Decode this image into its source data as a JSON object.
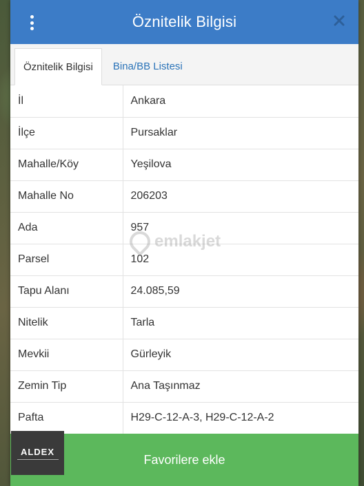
{
  "header": {
    "title": "Öznitelik Bilgisi",
    "colors": {
      "header_bg": "#3c7cc7",
      "button_bg": "#5cb85c",
      "tab_link": "#2a73b8"
    }
  },
  "tabs": [
    {
      "label": "Öznitelik Bilgisi",
      "active": true
    },
    {
      "label": "Bina/BB Listesi",
      "active": false
    }
  ],
  "attributes": [
    {
      "key": "İl",
      "value": "Ankara"
    },
    {
      "key": "İlçe",
      "value": "Pursaklar"
    },
    {
      "key": "Mahalle/Köy",
      "value": "Yeşilova"
    },
    {
      "key": "Mahalle No",
      "value": "206203"
    },
    {
      "key": "Ada",
      "value": "957"
    },
    {
      "key": "Parsel",
      "value": "102"
    },
    {
      "key": "Tapu Alanı",
      "value": "24.085,59"
    },
    {
      "key": "Nitelik",
      "value": "Tarla"
    },
    {
      "key": "Mevkii",
      "value": "Gürleyik"
    },
    {
      "key": "Zemin Tip",
      "value": "Ana Taşınmaz"
    },
    {
      "key": "Pafta",
      "value": "H29-C-12-A-3, H29-C-12-A-2"
    }
  ],
  "watermark": "emlakjet",
  "logo": "ALDEX",
  "footer": {
    "button_label": "Favorilere ekle"
  }
}
